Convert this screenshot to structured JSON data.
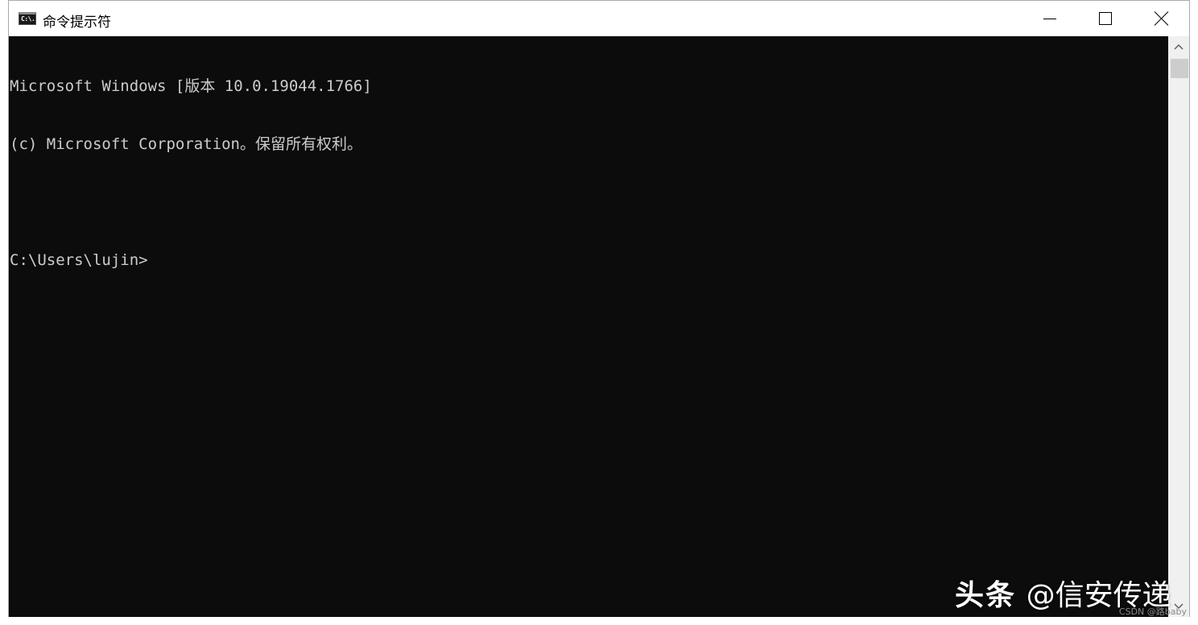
{
  "window": {
    "title": "命令提示符",
    "icon": "cmd-console-icon",
    "icon_glyph": "C:\\.",
    "controls": {
      "minimize": "minimize-icon",
      "maximize": "maximize-icon",
      "close": "close-icon"
    }
  },
  "console": {
    "lines": [
      "Microsoft Windows [版本 10.0.19044.1766]",
      "(c) Microsoft Corporation。保留所有权利。",
      "",
      "C:\\Users\\lujin>"
    ],
    "background": "#0c0c0c",
    "foreground": "#cccccc"
  },
  "scrollbar": {
    "up_icon": "chevron-up-icon",
    "down_icon": "chevron-down-icon"
  },
  "watermarks": {
    "brand": "头条",
    "handle": "@信安传递",
    "csdn": "CSDN @路baby"
  }
}
